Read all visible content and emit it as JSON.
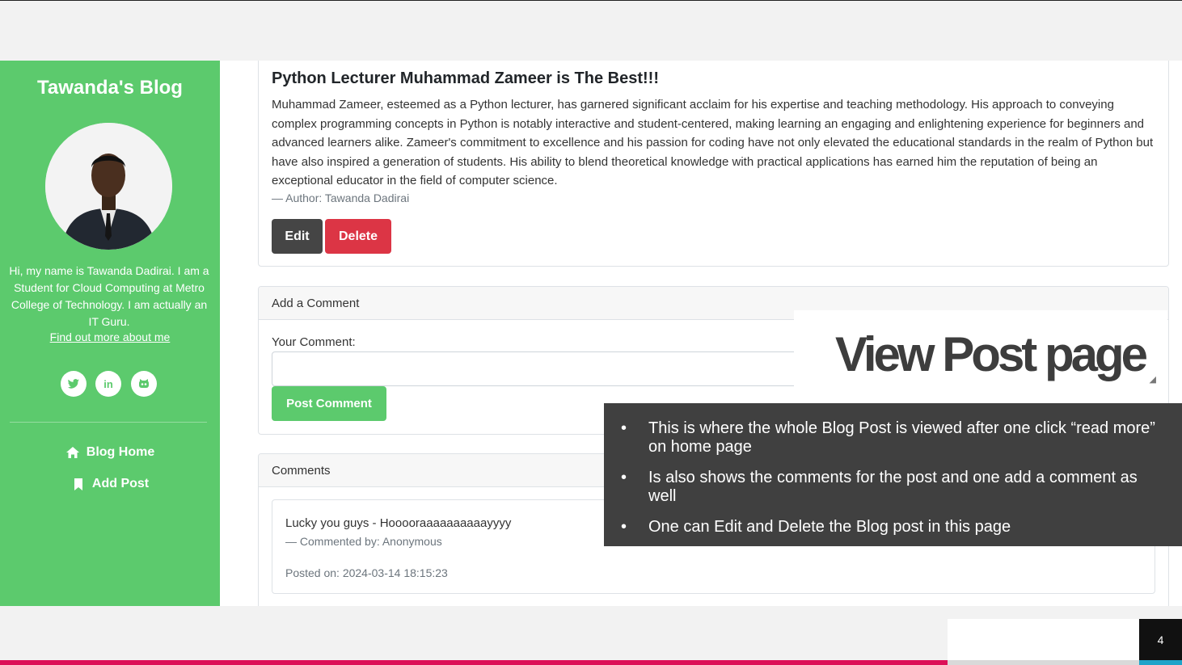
{
  "sidebar": {
    "blog_title": "Tawanda's Blog",
    "bio": "Hi, my name is Tawanda Dadirai. I am a Student for Cloud Computing at Metro College of Technology. I am actually an IT Guru.",
    "about_link": "Find out more about me",
    "social": [
      "twitter-icon",
      "linkedin-icon",
      "github-icon"
    ],
    "nav": [
      {
        "label": "Blog Home",
        "icon": "home-icon"
      },
      {
        "label": "Add Post",
        "icon": "bookmark-icon"
      }
    ],
    "accent_color": "#5cca6d"
  },
  "post": {
    "title": "Python Lecturer Muhammad Zameer is The Best!!!",
    "body": "Muhammad Zameer, esteemed as a Python lecturer, has garnered significant acclaim for his expertise and teaching methodology. His approach to conveying complex programming concepts in Python is notably interactive and student-centered, making learning an engaging and enlightening experience for beginners and advanced learners alike. Zameer's commitment to excellence and his passion for coding have not only elevated the educational standards in the realm of Python but have also inspired a generation of students. His ability to blend theoretical knowledge with practical applications has earned him the reputation of being an exceptional educator in the field of computer science.",
    "author": "— Author: Tawanda Dadirai",
    "edit_label": "Edit",
    "delete_label": "Delete"
  },
  "comment_form": {
    "header": "Add a Comment",
    "label": "Your Comment:",
    "submit_label": "Post Comment"
  },
  "comments": {
    "header": "Comments",
    "items": [
      {
        "text": "Lucky you guys - Hooooraaaaaaaaaayyyy",
        "by": "— Commented by: Anonymous",
        "date": "Posted on: 2024-03-14 18:15:23"
      }
    ]
  },
  "slide": {
    "title": "View Post page",
    "notes": [
      "This is where the whole Blog Post is viewed after one click  “read more” on home page",
      "Is also shows the comments for the post and one add  a comment as well",
      "One can Edit and Delete the Blog post  in this page"
    ],
    "page_number": "4"
  }
}
